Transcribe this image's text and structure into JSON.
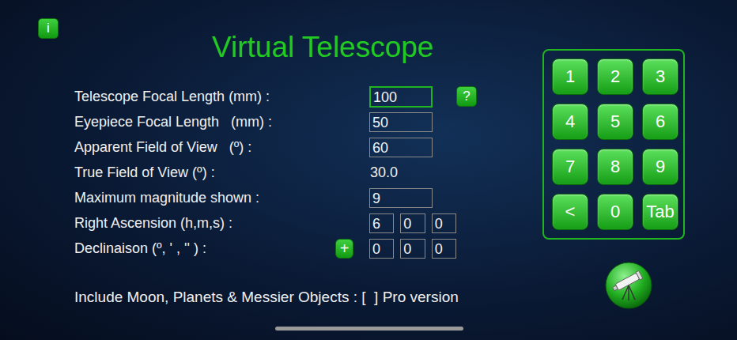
{
  "info_button": "i",
  "title": "Virtual Telescope",
  "help_button": "?",
  "fields": [
    {
      "label": "Telescope Focal Length (mm) :",
      "kind": "input",
      "value": "100",
      "focused": true
    },
    {
      "label": "Eyepiece Focal Length   (mm) :",
      "kind": "input",
      "value": "50",
      "focused": false
    },
    {
      "label": "Apparent Field of View   (º) :",
      "kind": "input",
      "value": "60",
      "focused": false
    },
    {
      "label": "True Field of View (º) :",
      "kind": "readout",
      "value": "30.0"
    },
    {
      "label": "Maximum magnitude shown :",
      "kind": "input",
      "value": "9",
      "focused": false
    },
    {
      "label": "Right Ascension (h,m,s) :",
      "kind": "triple",
      "values": [
        "6",
        "0",
        "0"
      ]
    },
    {
      "label": "Declinaison (º, ' , '' ) :",
      "kind": "triple",
      "sign": "+",
      "values": [
        "0",
        "0",
        "0"
      ]
    }
  ],
  "pro_option": "Include Moon, Planets & Messier Objects : [  ] Pro version",
  "keypad": [
    "1",
    "2",
    "3",
    "4",
    "5",
    "6",
    "7",
    "8",
    "9",
    "<",
    "0",
    "Tab"
  ]
}
